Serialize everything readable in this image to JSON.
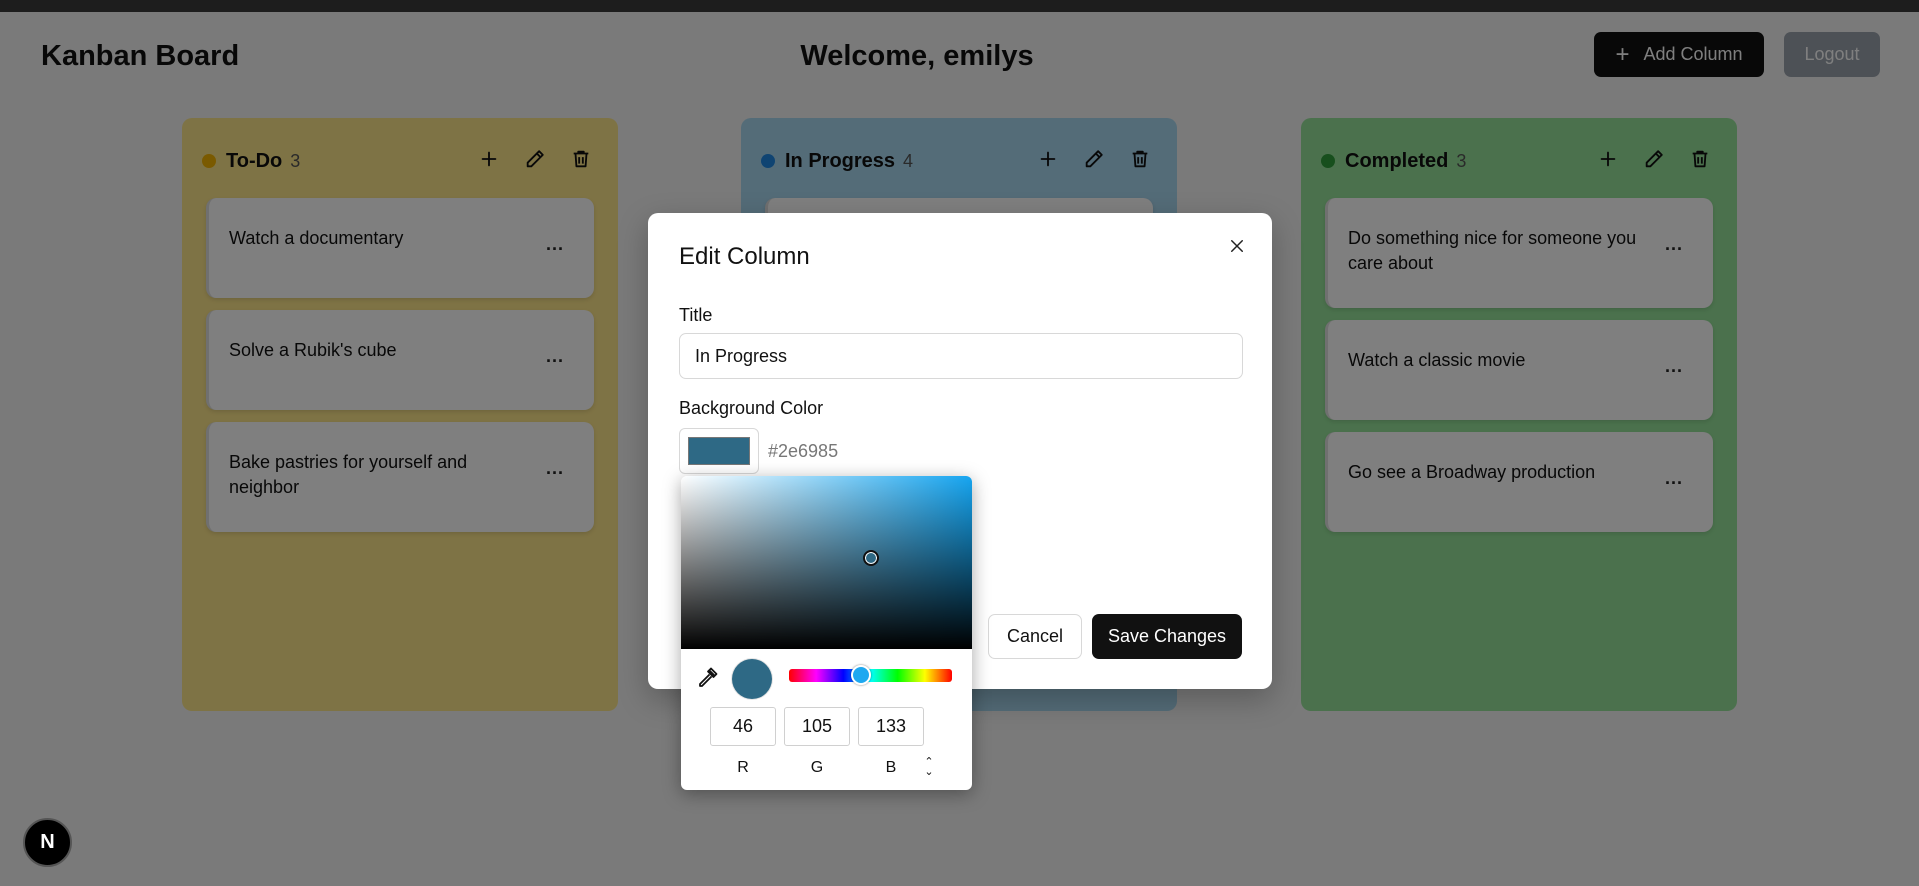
{
  "header": {
    "app_title": "Kanban Board",
    "welcome": "Welcome, emilys",
    "add_column_label": "Add Column",
    "logout_label": "Logout"
  },
  "columns": [
    {
      "title": "To-Do",
      "count": "3",
      "dot_color": "#f5b400",
      "background": "#fde68a",
      "cards": [
        {
          "text": "Watch a documentary"
        },
        {
          "text": "Solve a Rubik's cube"
        },
        {
          "text": "Bake pastries for yourself and neighbor"
        }
      ]
    },
    {
      "title": "In Progress",
      "count": "4",
      "dot_color": "#1e88e5",
      "background": "#a9d8f0",
      "cards": []
    },
    {
      "title": "Completed",
      "count": "3",
      "dot_color": "#2e9e3a",
      "background": "#96e39a",
      "cards": [
        {
          "text": "Do something nice for someone you care about"
        },
        {
          "text": "Watch a classic movie"
        },
        {
          "text": "Go see a Broadway production"
        }
      ]
    }
  ],
  "card_menu_label": "...",
  "modal": {
    "title": "Edit Column",
    "title_label": "Title",
    "title_value": "In Progress",
    "bg_label": "Background Color",
    "hex_value": "#2e6985",
    "cancel_label": "Cancel",
    "save_label": "Save Changes"
  },
  "picker": {
    "r": "46",
    "g": "105",
    "b": "133",
    "r_label": "R",
    "g_label": "G",
    "b_label": "B",
    "selected_color": "#2e6985"
  },
  "badge": {
    "letter": "N"
  },
  "icons": {
    "add": "plus-icon",
    "edit": "pencil-icon",
    "delete": "trash-icon",
    "close": "close-icon",
    "eyedropper": "eyedropper-icon"
  }
}
